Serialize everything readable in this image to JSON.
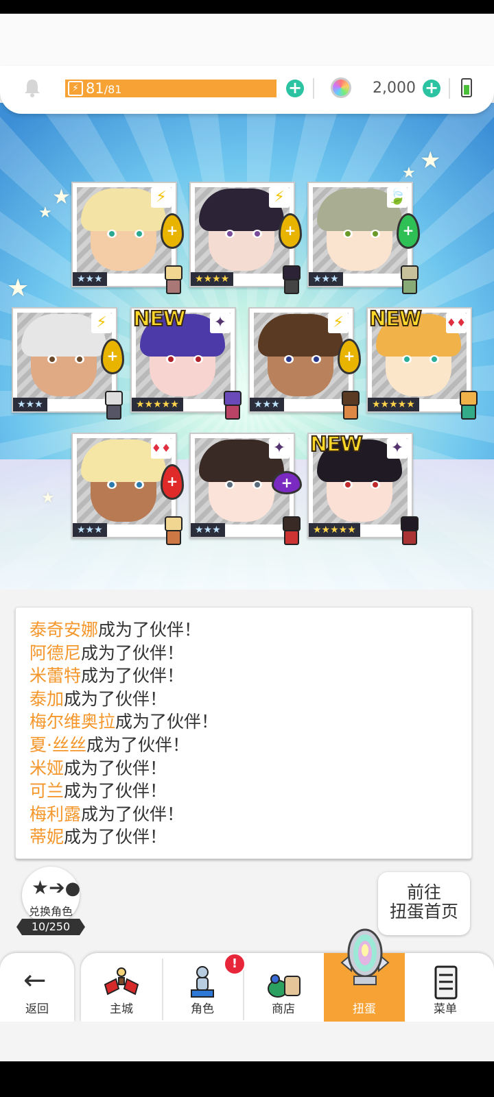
{
  "header": {
    "stamina_current": "81",
    "stamina_max": "/81",
    "stamina_fraction": 1.0,
    "gems": "2,000",
    "colors": {
      "stamina": "#f7a234",
      "plus": "#2cc3a2"
    }
  },
  "cards": [
    {
      "rank": "★★★",
      "element": "⚡",
      "new": ""
    },
    {
      "rank": "★★★★",
      "element": "⚡",
      "new": ""
    },
    {
      "rank": "★★★",
      "element": "🍃",
      "new": ""
    },
    {
      "rank": "★★★",
      "element": "⚡",
      "new": ""
    },
    {
      "rank": "★★★★★",
      "element": "✦",
      "new": "NEW"
    },
    {
      "rank": "★★★",
      "element": "⚡",
      "new": ""
    },
    {
      "rank": "★★★★★",
      "element": "♦♦",
      "new": "NEW"
    },
    {
      "rank": "★★★",
      "element": "♦♦",
      "new": ""
    },
    {
      "rank": "★★★",
      "element": "✦",
      "new": ""
    },
    {
      "rank": "★★★★★",
      "element": "✦",
      "new": "NEW"
    }
  ],
  "log": {
    "suffix": "成为了伙伴！",
    "names": [
      "泰奇安娜",
      "阿德尼",
      "米蕾特",
      "泰加",
      "梅尔维奥拉",
      "夏·丝丝",
      "米娅",
      "可兰",
      "梅利露",
      "蒂妮"
    ]
  },
  "exchange": {
    "label": "兑换角色",
    "count": "10/250"
  },
  "goto": {
    "line1": "前往",
    "line2": "扭蛋首页"
  },
  "nav": {
    "back": "返回",
    "items": [
      "主城",
      "角色",
      "商店",
      "扭蛋",
      "菜单"
    ],
    "active": "扭蛋",
    "badge": "!"
  }
}
